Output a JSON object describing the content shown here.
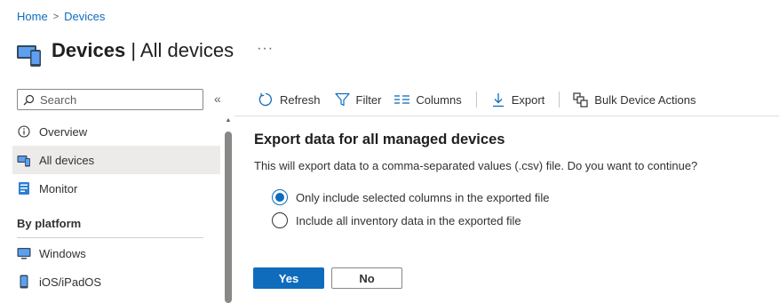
{
  "breadcrumb": [
    {
      "label": "Home"
    },
    {
      "label": "Devices"
    }
  ],
  "header": {
    "title_bold": "Devices",
    "title_rest": "| All devices",
    "more": "···"
  },
  "sidebar": {
    "search_placeholder": "Search",
    "collapse": "«",
    "items": [
      {
        "label": "Overview",
        "icon": "info-icon"
      },
      {
        "label": "All devices",
        "icon": "devices-icon",
        "active": true
      },
      {
        "label": "Monitor",
        "icon": "monitor-icon"
      }
    ],
    "section": "By platform",
    "platform_items": [
      {
        "label": "Windows",
        "icon": "windows-icon"
      },
      {
        "label": "iOS/iPadOS",
        "icon": "phone-icon"
      }
    ]
  },
  "toolbar": {
    "refresh": "Refresh",
    "filter": "Filter",
    "columns": "Columns",
    "export": "Export",
    "bulk": "Bulk Device Actions"
  },
  "dialog": {
    "title": "Export data for all managed devices",
    "message": "This will export data to a comma-separated values (.csv) file. Do you want to continue?",
    "options": [
      {
        "label": "Only include selected columns in the exported file",
        "selected": true
      },
      {
        "label": "Include all inventory data in the exported file",
        "selected": false
      }
    ],
    "yes": "Yes",
    "no": "No"
  },
  "colors": {
    "accent": "#0f6cbd",
    "active_nav": "#edebe9"
  }
}
